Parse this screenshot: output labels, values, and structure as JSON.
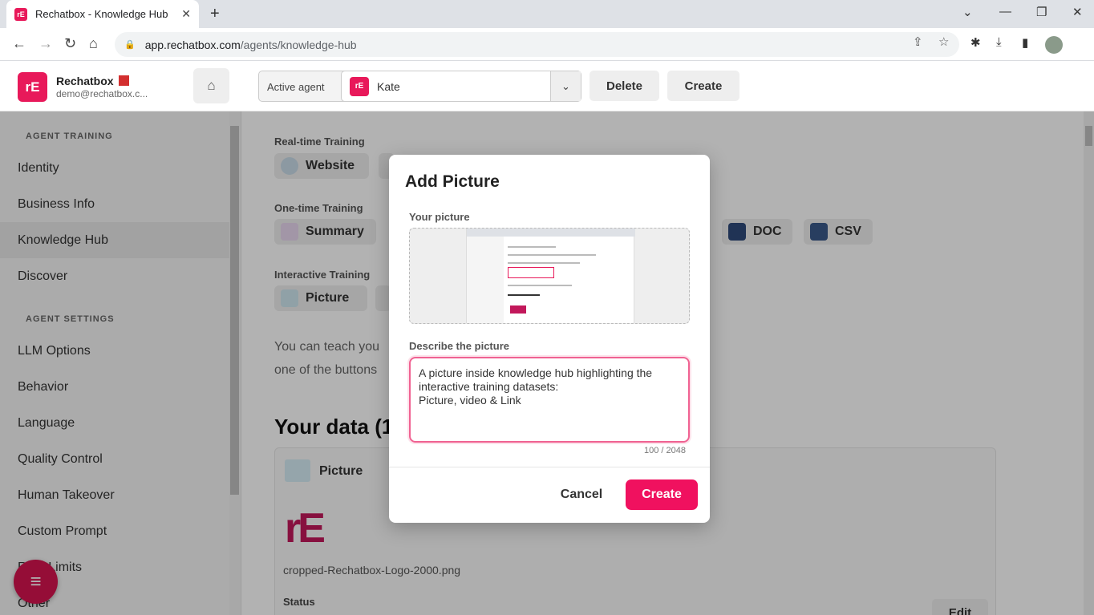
{
  "browser": {
    "tab_title": "Rechatbox - Knowledge Hub",
    "url_host": "app.rechatbox.com",
    "url_path": "/agents/knowledge-hub"
  },
  "header": {
    "brand": "Rechatbox",
    "email": "demo@rechatbox.c...",
    "active_agent_label": "Active agent",
    "agent_name": "Kate",
    "delete_label": "Delete",
    "create_label": "Create"
  },
  "sidebar": {
    "section_training": "AGENT TRAINING",
    "section_settings": "AGENT SETTINGS",
    "items": [
      {
        "label": "Identity"
      },
      {
        "label": "Business Info"
      },
      {
        "label": "Knowledge Hub"
      },
      {
        "label": "Discover"
      },
      {
        "label": "LLM Options"
      },
      {
        "label": "Behavior"
      },
      {
        "label": "Language"
      },
      {
        "label": "Quality Control"
      },
      {
        "label": "Human Takeover"
      },
      {
        "label": "Custom Prompt"
      },
      {
        "label": "Rate Limits"
      },
      {
        "label": "Other"
      }
    ]
  },
  "main": {
    "realtime_label": "Real-time Training",
    "website_chip": "Website",
    "onetime_label": "One-time Training",
    "summary_chip": "Summary",
    "doc_chip": "DOC",
    "csv_chip": "CSV",
    "interactive_label": "Interactive Training",
    "picture_chip": "Picture",
    "body_line1": "You can teach you",
    "body_line2": "one of the buttons",
    "data_title": "Your data (1",
    "card": {
      "title": "Picture",
      "logo_text": "rE",
      "filename": "cropped-Rechatbox-Logo-2000.png",
      "status_label": "Status",
      "edit_label": "Edit"
    }
  },
  "modal": {
    "title": "Add Picture",
    "picture_label": "Your picture",
    "describe_label": "Describe the picture",
    "description": "A picture inside knowledge hub highlighting the interactive training datasets:\nPicture, video & Link",
    "counter": "100 / 2048",
    "cancel_label": "Cancel",
    "create_label": "Create"
  },
  "colors": {
    "brand": "#e8195a",
    "create_button": "#f0115f"
  }
}
